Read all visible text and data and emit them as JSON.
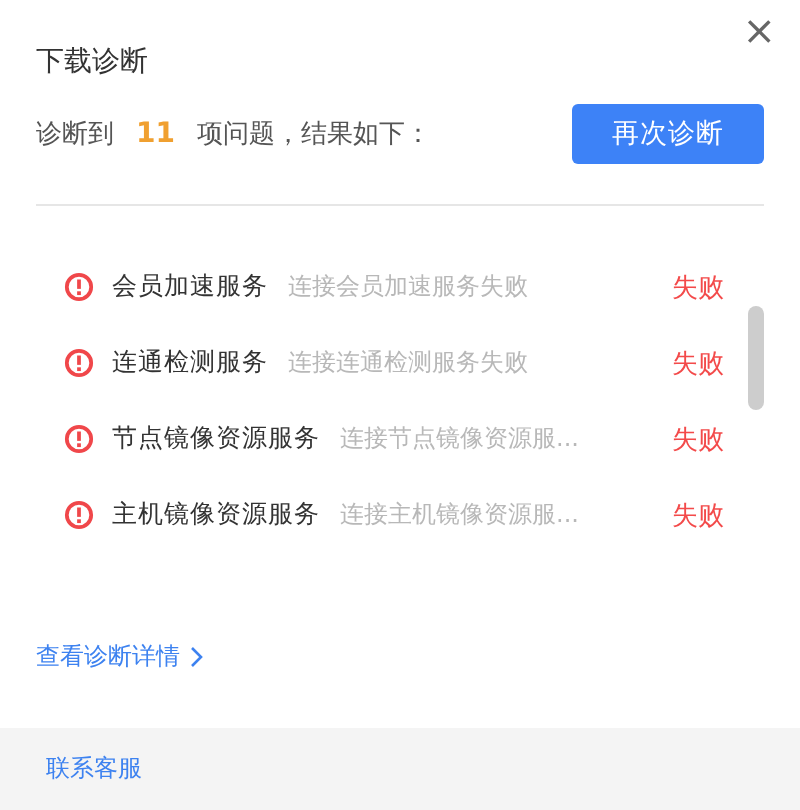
{
  "dialog": {
    "title": "下载诊断",
    "close": "×"
  },
  "summary": {
    "prefix": "诊断到",
    "count": "11",
    "suffix": "项问题，结果如下："
  },
  "retry_button": "再次诊断",
  "results": [
    {
      "name": "会员加速服务",
      "detail": "连接会员加速服务失败",
      "status": "失败"
    },
    {
      "name": "连通检测服务",
      "detail": "连接连通检测服务失败",
      "status": "失败"
    },
    {
      "name": "节点镜像资源服务",
      "detail": "连接节点镜像资源服...",
      "status": "失败"
    },
    {
      "name": "主机镜像资源服务",
      "detail": "连接主机镜像资源服...",
      "status": "失败"
    }
  ],
  "details_link": "查看诊断详情",
  "footer": {
    "link": "联系客服"
  }
}
